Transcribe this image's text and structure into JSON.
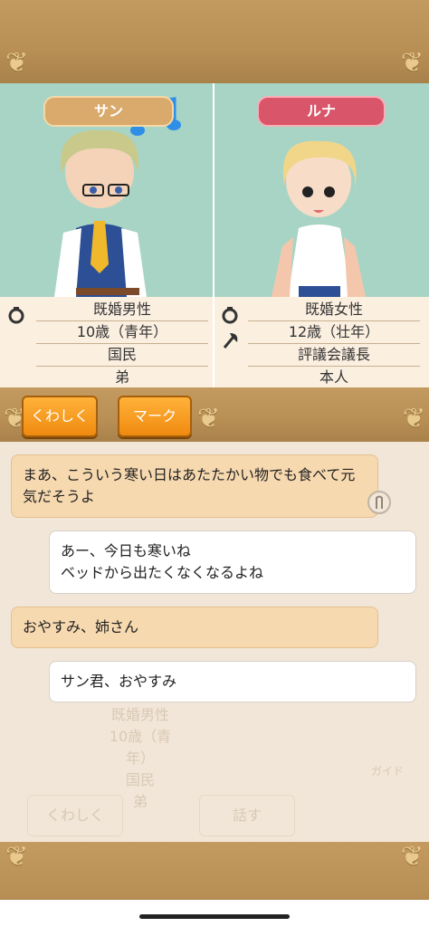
{
  "left_character": {
    "name": "サン",
    "info": [
      "既婚男性",
      "10歳（青年）",
      "国民",
      "弟"
    ]
  },
  "right_character": {
    "name": "ルナ",
    "info": [
      "既婚女性",
      "12歳（壮年）",
      "評議会議長",
      "本人"
    ]
  },
  "buttons": {
    "details": "くわしく",
    "mark": "マーク"
  },
  "messages": [
    {
      "side": "left",
      "text": "まあ、こういう寒い日はあたたかい物でも食べて元気だそうよ"
    },
    {
      "side": "right",
      "text": "あー、今日も寒いね\nベッドから出たくなくなるよね"
    },
    {
      "side": "left",
      "text": "おやすみ、姉さん"
    },
    {
      "side": "right",
      "text": "サン君、おやすみ"
    }
  ],
  "background_ghost": {
    "info": [
      "既婚男性",
      "10歳（青年）",
      "国民",
      "弟"
    ],
    "details": "くわしく",
    "talk": "話す",
    "guide": "ガイド"
  },
  "icons": [
    "ring-icon",
    "axe-icon",
    "music-note-icon"
  ]
}
